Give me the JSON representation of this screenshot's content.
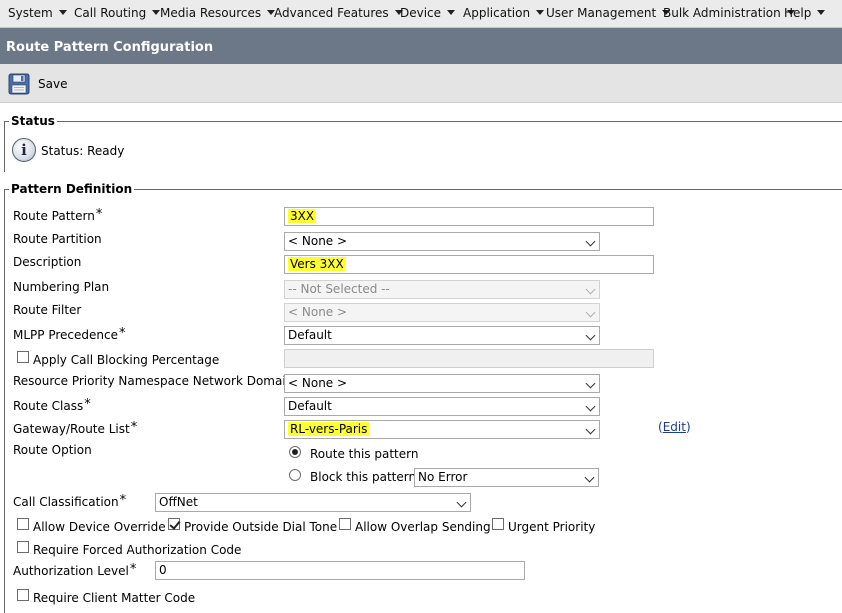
{
  "menu": {
    "items": [
      {
        "label": "System"
      },
      {
        "label": "Call Routing"
      },
      {
        "label": "Media Resources"
      },
      {
        "label": "Advanced Features"
      },
      {
        "label": "Device"
      },
      {
        "label": "Application"
      },
      {
        "label": "User Management"
      },
      {
        "label": "Bulk Administration"
      },
      {
        "label": "Help"
      }
    ]
  },
  "page": {
    "title": "Route Pattern Configuration"
  },
  "toolbar": {
    "save_label": "Save",
    "save_icon": "floppy-disk-icon"
  },
  "status": {
    "legend": "Status",
    "text": "Status: Ready",
    "icon_glyph": "i"
  },
  "pattern": {
    "legend": "Pattern Definition",
    "route_pattern": {
      "label": "Route Pattern",
      "required": "*",
      "value": "3XX"
    },
    "route_partition": {
      "label": "Route Partition",
      "value": "< None >"
    },
    "description": {
      "label": "Description",
      "value": "Vers 3XX"
    },
    "numbering_plan": {
      "label": "Numbering Plan",
      "value": "-- Not Selected --"
    },
    "route_filter": {
      "label": "Route Filter",
      "value": "< None >"
    },
    "mlpp_precedence": {
      "label": "MLPP Precedence",
      "required": "*",
      "value": "Default"
    },
    "apply_call_blocking": {
      "label": "Apply Call Blocking Percentage",
      "checked": false,
      "value": ""
    },
    "resource_priority": {
      "label": "Resource Priority Namespace Network Domain",
      "value": "< None >"
    },
    "route_class": {
      "label": "Route Class",
      "required": "*",
      "value": "Default"
    },
    "gateway_route_list": {
      "label": "Gateway/Route List",
      "required": "*",
      "value": "RL-vers-Paris",
      "edit_open": "(",
      "edit_label": "Edit",
      "edit_close": ")"
    },
    "route_option": {
      "label": "Route Option",
      "route_this_pattern": "Route this pattern",
      "block_this_pattern": "Block this pattern",
      "block_reason": "No Error",
      "selected": "Route this pattern"
    },
    "call_classification": {
      "label": "Call Classification",
      "required": "*",
      "value": "OffNet"
    },
    "allow_device_override": {
      "label": "Allow Device Override",
      "checked": false
    },
    "provide_outside_dial_tone": {
      "label": "Provide Outside Dial Tone",
      "checked": true
    },
    "allow_overlap_sending": {
      "label": "Allow Overlap Sending",
      "checked": false
    },
    "urgent_priority": {
      "label": "Urgent Priority",
      "checked": false
    },
    "require_forced_auth": {
      "label": "Require Forced Authorization Code",
      "checked": false
    },
    "authorization_level": {
      "label": "Authorization Level",
      "required": "*",
      "value": "0"
    },
    "require_client_matter": {
      "label": "Require Client Matter Code",
      "checked": false
    }
  },
  "colors": {
    "highlight": "#ffff33",
    "title_bar": "#6c7787",
    "link": "#1a3f8c"
  }
}
